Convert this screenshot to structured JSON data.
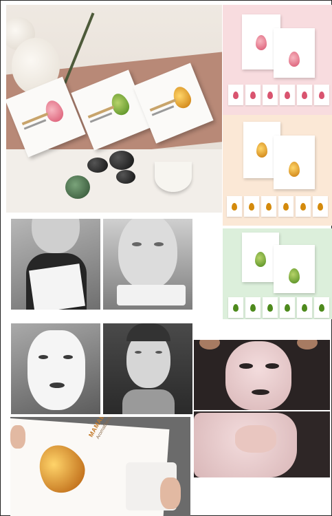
{
  "collage": {
    "hero": {
      "products": [
        "rose",
        "green",
        "amber"
      ]
    },
    "panels": [
      {
        "name": "pink",
        "drop_color": "#d9546f"
      },
      {
        "name": "peach",
        "drop_color": "#d48a0c"
      },
      {
        "name": "green",
        "drop_color": "#4e8a1d"
      }
    ],
    "sachet_photo": {
      "brand": "MAMABABY",
      "subtitle": "Aromatherapy Mask"
    }
  },
  "colors": {
    "pink_bg": "#f8dcdf",
    "peach_bg": "#fbe8d6",
    "green_bg": "#dcefdb",
    "border": "#222222"
  }
}
